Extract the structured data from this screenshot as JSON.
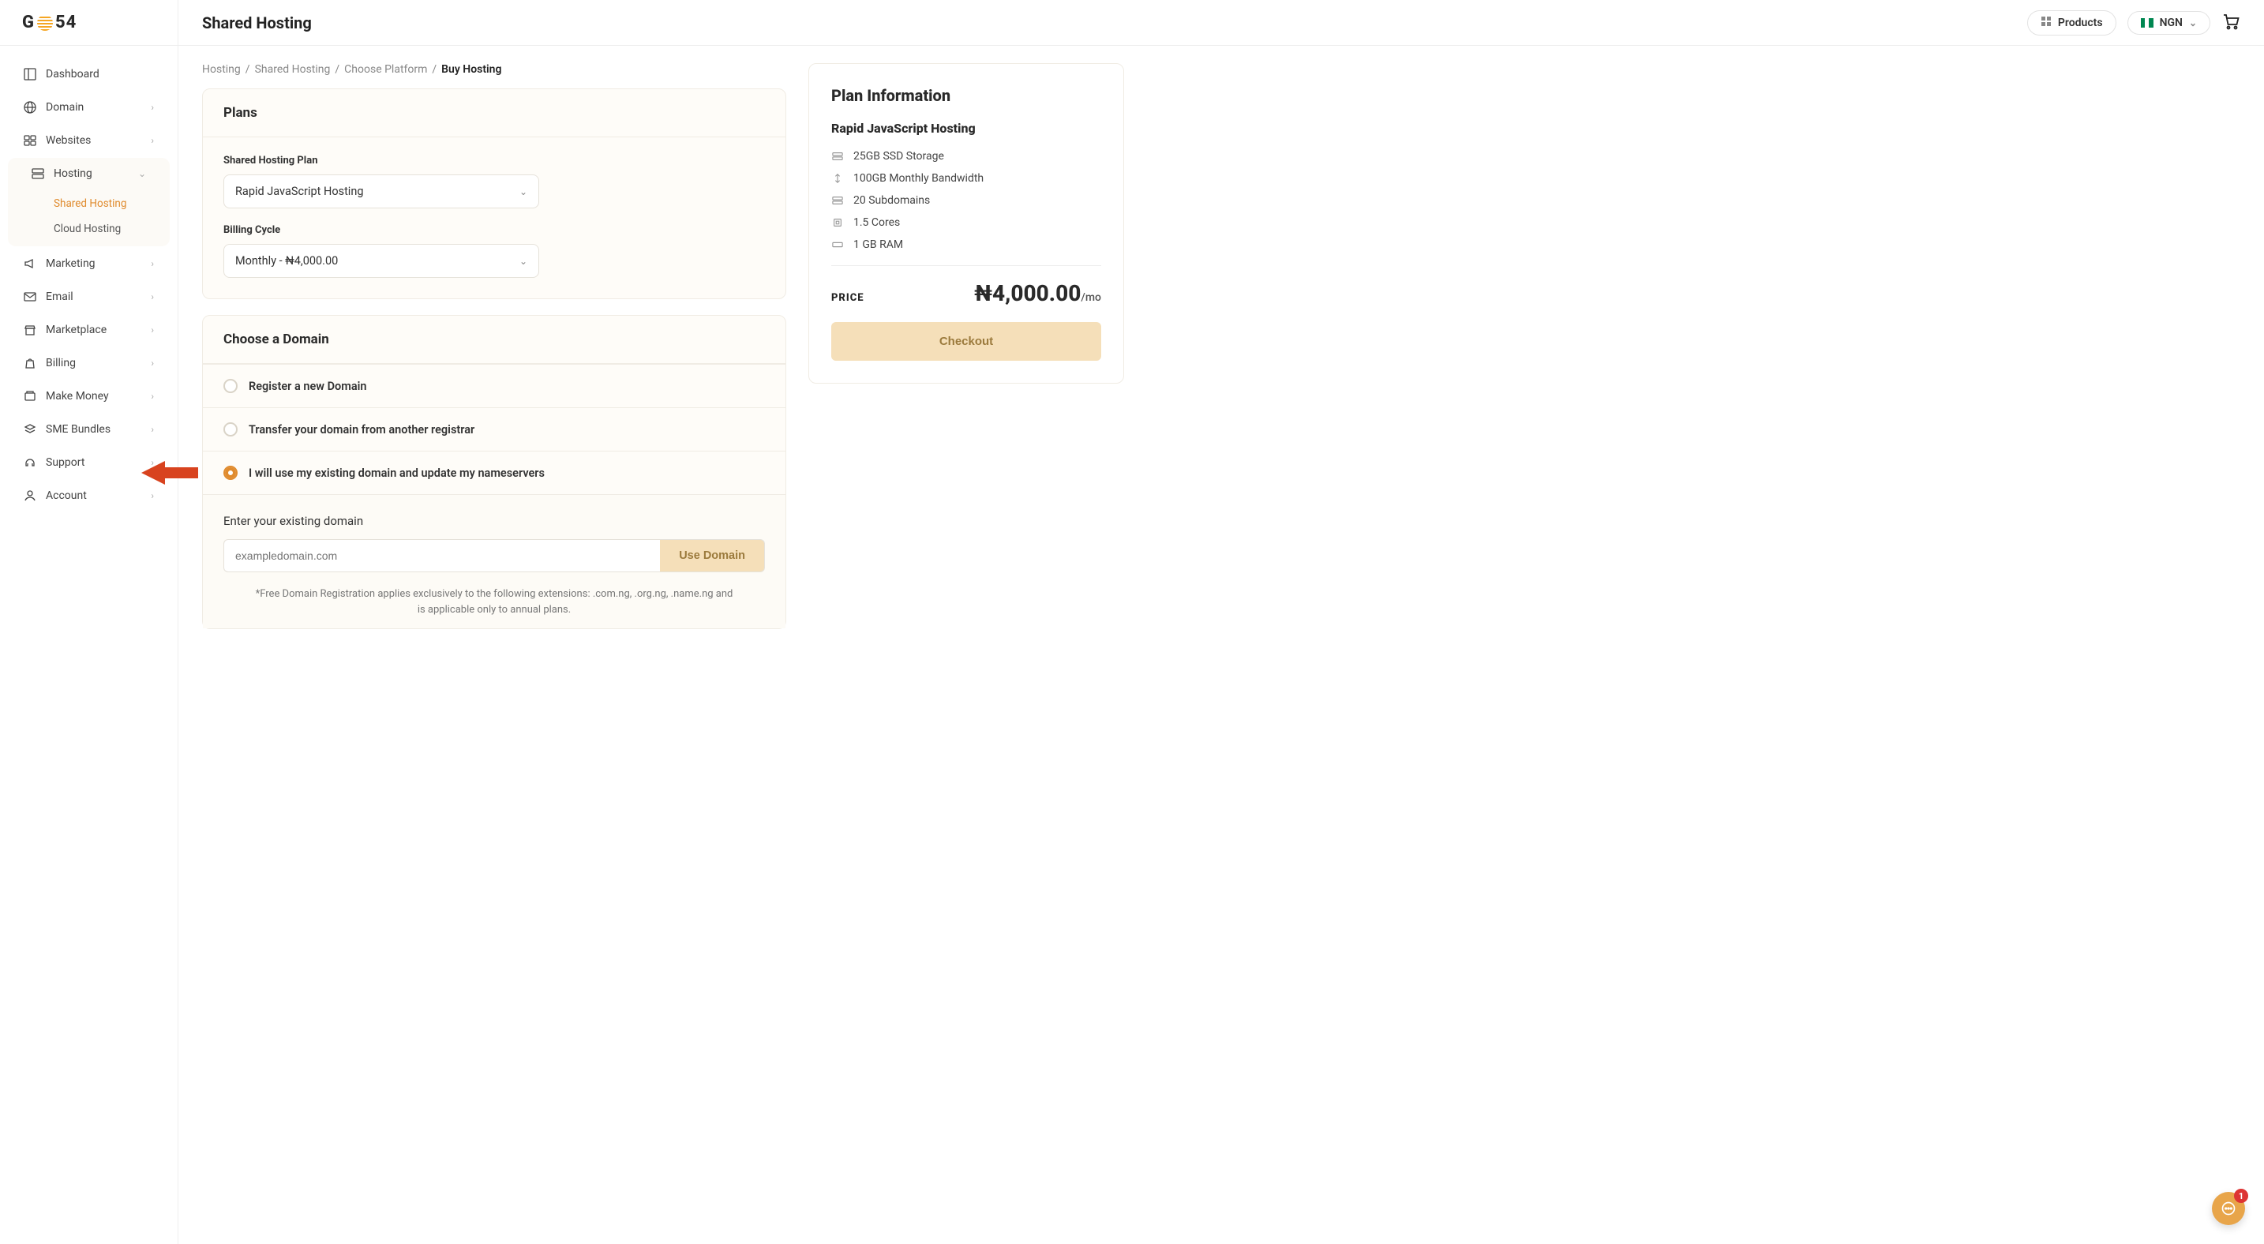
{
  "logo": {
    "prefix": "G",
    "suffix": "54"
  },
  "page_title": "Shared Hosting",
  "topbar": {
    "products_label": "Products",
    "currency_label": "NGN"
  },
  "sidebar": {
    "items": [
      {
        "label": "Dashboard",
        "icon": "dashboard",
        "expandable": false
      },
      {
        "label": "Domain",
        "icon": "globe",
        "expandable": true
      },
      {
        "label": "Websites",
        "icon": "sites",
        "expandable": true
      },
      {
        "label": "Hosting",
        "icon": "server",
        "expandable": true,
        "expanded": true,
        "children": [
          {
            "label": "Shared Hosting",
            "active": true
          },
          {
            "label": "Cloud Hosting",
            "active": false
          }
        ]
      },
      {
        "label": "Marketing",
        "icon": "megaphone",
        "expandable": true
      },
      {
        "label": "Email",
        "icon": "envelope",
        "expandable": true
      },
      {
        "label": "Marketplace",
        "icon": "store",
        "expandable": true
      },
      {
        "label": "Billing",
        "icon": "bag",
        "expandable": true
      },
      {
        "label": "Make Money",
        "icon": "wallet",
        "expandable": true
      },
      {
        "label": "SME Bundles",
        "icon": "layers",
        "expandable": true
      },
      {
        "label": "Support",
        "icon": "headset",
        "expandable": true
      },
      {
        "label": "Account",
        "icon": "user",
        "expandable": true
      }
    ]
  },
  "breadcrumbs": [
    {
      "label": "Hosting"
    },
    {
      "label": "Shared Hosting"
    },
    {
      "label": "Choose Platform"
    },
    {
      "label": "Buy Hosting",
      "last": true
    }
  ],
  "plans": {
    "title": "Plans",
    "plan_label": "Shared Hosting Plan",
    "plan_value": "Rapid JavaScript Hosting",
    "cycle_label": "Billing Cycle",
    "cycle_value": "Monthly - ₦4,000.00"
  },
  "domain_section": {
    "title": "Choose a Domain",
    "options": [
      {
        "label": "Register a new Domain",
        "checked": false
      },
      {
        "label": "Transfer your domain from another registrar",
        "checked": false
      },
      {
        "label": "I will use my existing domain and update my nameservers",
        "checked": true
      }
    ],
    "existing_label": "Enter your existing domain",
    "placeholder": "exampledomain.com",
    "use_button": "Use Domain",
    "footnote": "*Free Domain Registration applies exclusively to the following extensions: .com.ng, .org.ng, .name.ng and is applicable only to annual plans."
  },
  "info": {
    "title": "Plan Information",
    "plan_name": "Rapid JavaScript Hosting",
    "features": [
      "25GB SSD Storage",
      "100GB Monthly Bandwidth",
      "20 Subdomains",
      "1.5 Cores",
      "1 GB RAM"
    ],
    "price_label": "PRICE",
    "price_value": "₦4,000.00",
    "price_suffix": "/mo",
    "checkout_label": "Checkout"
  },
  "chat_badge": "1"
}
